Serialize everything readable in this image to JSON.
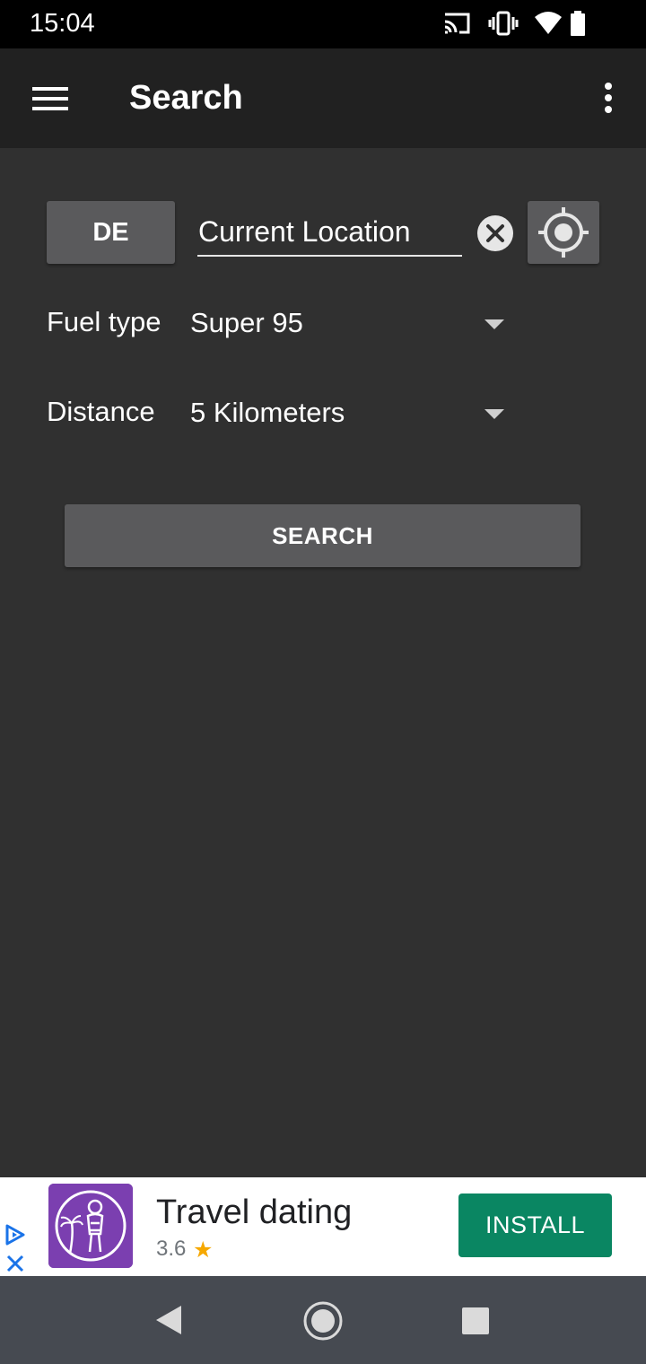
{
  "status_bar": {
    "time": "15:04",
    "icons": [
      "cast-icon",
      "vibrate-icon",
      "wifi-icon",
      "battery-icon"
    ]
  },
  "app_bar": {
    "title": "Search",
    "menu_icon": "hamburger-menu-icon",
    "overflow_icon": "more-vert-icon"
  },
  "search_form": {
    "country_code": "DE",
    "location_value": "Current Location",
    "clear_icon": "clear-circle-icon",
    "locate_icon": "gps-locate-icon",
    "fuel_type": {
      "label": "Fuel type",
      "selected": "Super 95"
    },
    "distance": {
      "label": "Distance",
      "selected": "5 Kilometers"
    },
    "search_button": "SEARCH"
  },
  "ad": {
    "app_name": "Travel dating",
    "rating": "3.6",
    "star": "★",
    "install_label": "INSTALL",
    "icon": "travel-dating-app-icon"
  },
  "nav_bar": {
    "icons": [
      "back-icon",
      "home-icon",
      "recents-icon"
    ]
  },
  "colors": {
    "background": "#303030",
    "app_bar": "#212121",
    "button": "#5a5a5c",
    "install": "#0a8662",
    "rating_star": "#f6a800"
  }
}
